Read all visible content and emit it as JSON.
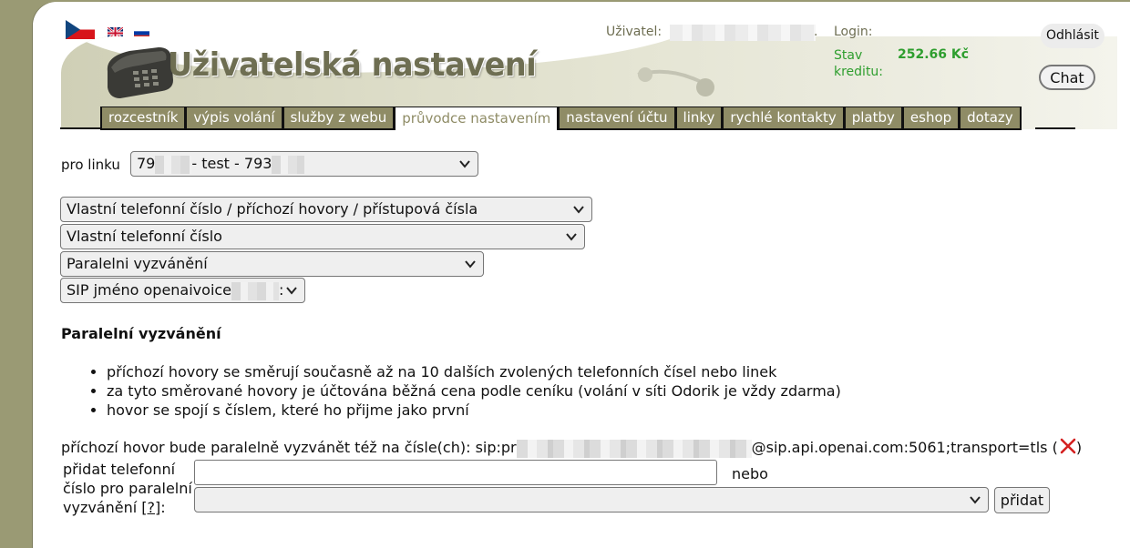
{
  "header": {
    "title": "Uživatelská nastavení",
    "user_label": "Uživatel:",
    "user_suffix": ".",
    "login_label": "Login:",
    "credit_label": "Stav kreditu:",
    "credit_value": "252.66 Kč",
    "logout_label": "Odhlásit",
    "chat_label": "Chat",
    "languages": [
      "cs",
      "en",
      "ru"
    ]
  },
  "nav": {
    "tabs": [
      {
        "label": "rozcestník",
        "active": false
      },
      {
        "label": "výpis volání",
        "active": false
      },
      {
        "label": "služby z webu",
        "active": false
      },
      {
        "label": "průvodce nastavením",
        "active": true
      },
      {
        "label": "nastavení účtu",
        "active": false
      },
      {
        "label": "linky",
        "active": false
      },
      {
        "label": "rychlé kontakty",
        "active": false
      },
      {
        "label": "platby",
        "active": false
      },
      {
        "label": "eshop",
        "active": false
      },
      {
        "label": "dotazy",
        "active": false
      }
    ]
  },
  "line_selector": {
    "label": "pro linku",
    "value_prefix": "79",
    "value_middle": "- test - 793"
  },
  "selects": {
    "category": "Vlastní telefonní číslo / příchozí hovory / přístupová čísla",
    "subcategory": "Vlastní telefonní číslo",
    "feature": "Paralelni vyzvánění",
    "sip_name_prefix": "SIP jméno openaivoice",
    "sip_name_suffix": ":"
  },
  "section": {
    "title": "Paralelní vyzvánění",
    "bullets": [
      "příchozí hovory se směrují současně až na 10 dalších zvolených telefonních čísel nebo linek",
      "za tyto směrované hovory je účtována běžná cena podle ceníku (volání v síti Odorik je vždy zdarma)",
      "hovor se spojí s číslem, které ho přijme jako první"
    ]
  },
  "parallel": {
    "label": "příchozí hovor bude paralelně vyzvánět též na čísle(ch): sip:pr",
    "suffix": "@sip.api.openai.com:5061;transport=tls (",
    "close_paren": ")"
  },
  "add_form": {
    "label_line1": "přidat telefonní číslo pro paralelní vyzvánění [",
    "help": "?",
    "label_end": "]:",
    "input_value": "",
    "or_label": "nebo",
    "select_value": "",
    "add_button": "přidat"
  },
  "colors": {
    "nav_tab": "#8f8c66",
    "credit": "#2e9e2e",
    "delete": "#d42020"
  }
}
